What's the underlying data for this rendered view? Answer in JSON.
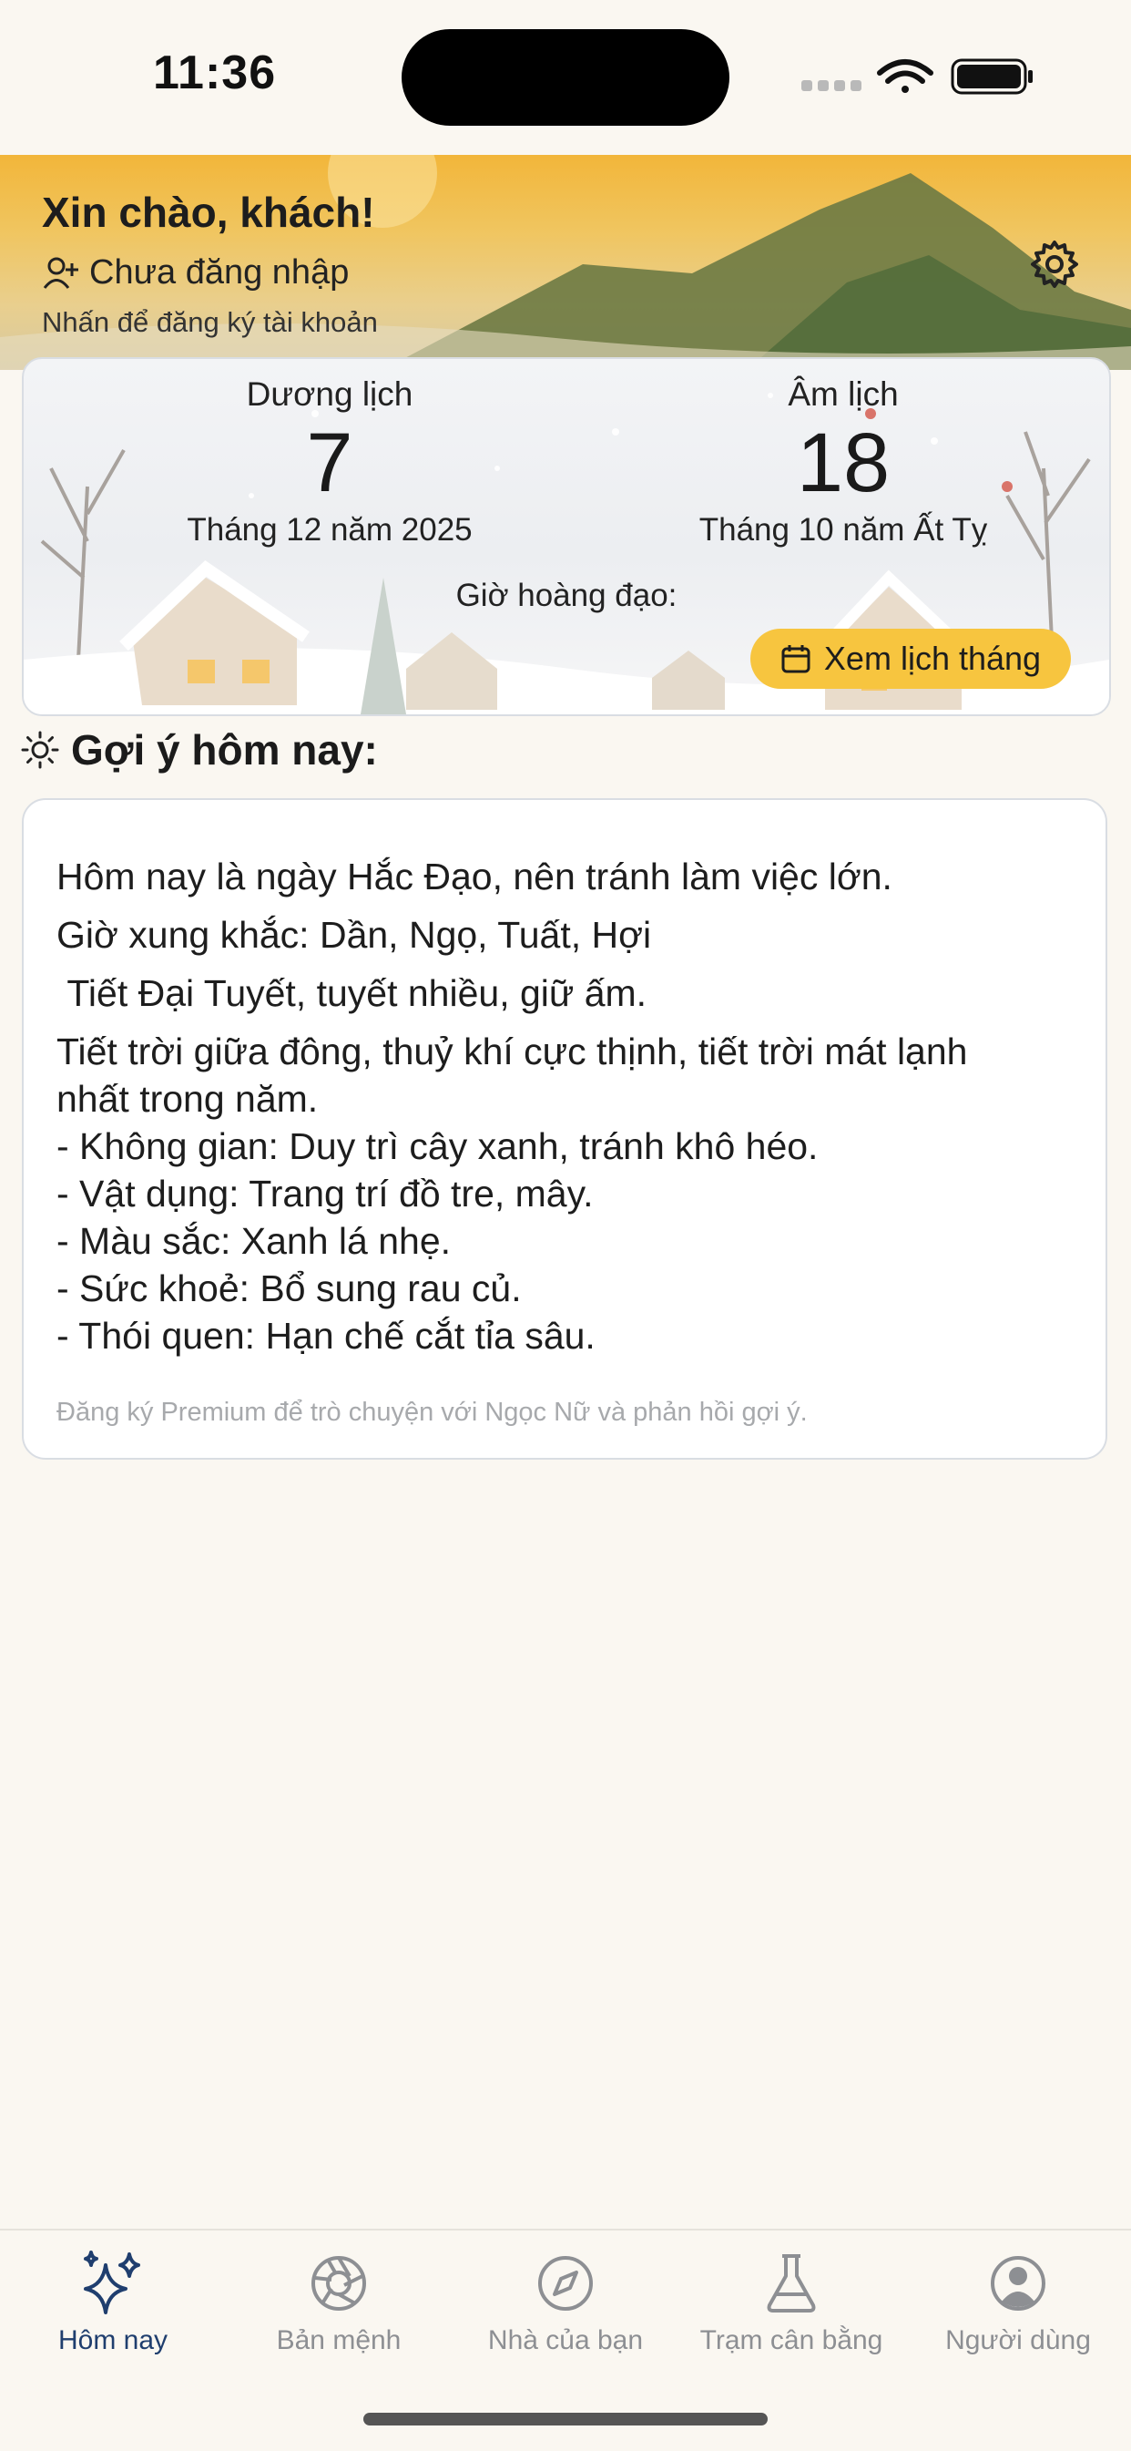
{
  "status_bar": {
    "time": "11:36"
  },
  "header": {
    "greeting": "Xin chào, khách!",
    "login_status": "Chưa đăng nhập",
    "login_hint": "Nhấn để đăng ký tài khoản",
    "settings_icon": "gear-icon"
  },
  "calendar": {
    "solar": {
      "label": "Dương lịch",
      "day": "7",
      "month_year": "Tháng 12 năm 2025"
    },
    "lunar": {
      "label": "Âm lịch",
      "day": "18",
      "month_year": "Tháng 10 năm Ất Tỵ"
    },
    "auspicious_hours_label": "Giờ hoàng đạo:",
    "month_button_label": "Xem lịch tháng"
  },
  "suggestions": {
    "title": "Gợi ý hôm nay:",
    "lines": [
      "Hôm nay là ngày Hắc Đạo, nên tránh làm việc lớn.",
      "Giờ xung khắc: Dần, Ngọ, Tuất, Hợi",
      " Tiết Đại Tuyết, tuyết nhiều, giữ ấm.",
      "Tiết trời giữa đông, thuỷ khí cực thịnh, tiết trời mát lạnh",
      "nhất trong năm.",
      "- Không gian: Duy trì cây xanh, tránh khô héo.",
      "- Vật dụng: Trang trí đồ tre, mây.",
      "- Màu sắc: Xanh lá nhẹ.",
      "- Sức khoẻ: Bổ sung rau củ.",
      "- Thói quen: Hạn chế cắt tỉa sâu."
    ],
    "premium_note": "Đăng ký Premium để trò chuyện với Ngọc Nữ và phản hồi gợi ý."
  },
  "tabs": [
    {
      "label": "Hôm nay",
      "icon": "sparkles-icon",
      "active": true
    },
    {
      "label": "Bản mệnh",
      "icon": "aperture-icon",
      "active": false
    },
    {
      "label": "Nhà của bạn",
      "icon": "compass-icon",
      "active": false
    },
    {
      "label": "Trạm cân bằng",
      "icon": "flask-icon",
      "active": false
    },
    {
      "label": "Người dùng",
      "icon": "user-circle-icon",
      "active": false
    }
  ],
  "colors": {
    "background": "#faf7f1",
    "accent_button": "#f7c53f",
    "active_tab": "#1f3e6e",
    "inactive_tab": "#8d8f93"
  }
}
